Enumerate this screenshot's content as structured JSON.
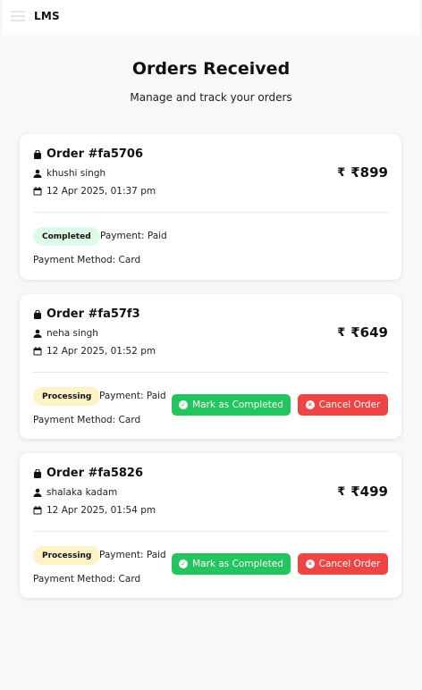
{
  "app": {
    "brand": "LMS"
  },
  "page": {
    "title": "Orders Received",
    "subtitle": "Manage and track your orders"
  },
  "labels": {
    "payment_prefix": "Payment: ",
    "method_prefix": "Payment Method: ",
    "mark_completed": "Mark as Completed",
    "cancel_order": "Cancel Order",
    "currency_symbol": "₹"
  },
  "orders": [
    {
      "id": "Order #fa5706",
      "customer": "khushi singh",
      "date": "12 Apr 2025, 01:37 pm",
      "amount": "₹899",
      "status": "Completed",
      "payment": "Payment: Paid",
      "method": "Payment Method: Card"
    },
    {
      "id": "Order #fa57f3",
      "customer": "neha singh",
      "date": "12 Apr 2025, 01:52 pm",
      "amount": "₹649",
      "status": "Processing",
      "payment": "Payment: Paid",
      "method": "Payment Method: Card"
    },
    {
      "id": "Order #fa5826",
      "customer": "shalaka kadam",
      "date": "12 Apr 2025, 01:54 pm",
      "amount": "₹499",
      "status": "Processing",
      "payment": "Payment: Paid",
      "method": "Payment Method: Card"
    }
  ],
  "colors": {
    "completed_badge": "#dcfce7",
    "processing_badge": "#fef3c7",
    "complete_button": "#22c55e",
    "cancel_button": "#ef4444"
  }
}
